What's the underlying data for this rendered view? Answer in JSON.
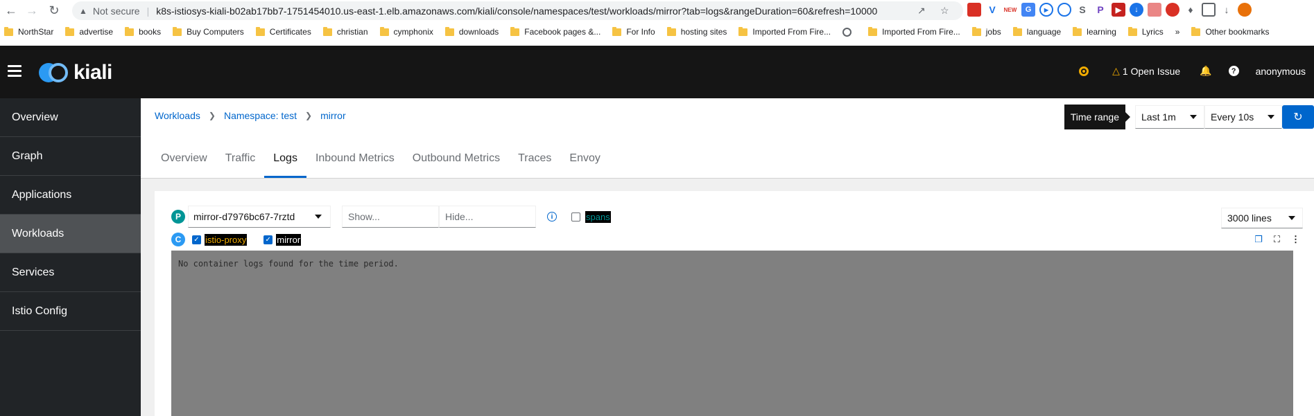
{
  "browser": {
    "not_secure": "Not secure",
    "url": "k8s-istiosys-kiali-b02ab17bb7-1751454010.us-east-1.elb.amazonaws.com/kiali/console/namespaces/test/workloads/mirror?tab=logs&rangeDuration=60&refresh=10000",
    "bookmarks": [
      "NorthStar",
      "advertise",
      "books",
      "Buy Computers",
      "Certificates",
      "christian",
      "cymphonix",
      "downloads",
      "Facebook pages &...",
      "For Info",
      "hosting sites",
      "Imported From Fire...",
      "Imported From Fire...",
      "jobs",
      "language",
      "learning",
      "Lyrics"
    ],
    "other_bookmarks": "Other bookmarks",
    "overflow": "»"
  },
  "masthead": {
    "logo_text": "kiali",
    "open_issue": "1 Open Issue",
    "user": "anonymous",
    "help": "?"
  },
  "sidebar": {
    "items": [
      "Overview",
      "Graph",
      "Applications",
      "Workloads",
      "Services",
      "Istio Config"
    ],
    "active": "Workloads"
  },
  "breadcrumb": {
    "items": [
      "Workloads",
      "Namespace: test",
      "mirror"
    ]
  },
  "toolbar": {
    "tooltip": "Time range",
    "time_range": "Last 1m",
    "refresh_interval": "Every 10s"
  },
  "tabs": {
    "items": [
      "Overview",
      "Traffic",
      "Logs",
      "Inbound Metrics",
      "Outbound Metrics",
      "Traces",
      "Envoy"
    ],
    "active": "Logs"
  },
  "logs": {
    "pod_badge": "P",
    "pod": "mirror-d7976bc67-7rztd",
    "show_placeholder": "Show...",
    "hide_placeholder": "Hide...",
    "info": "i",
    "spans_label": "spans",
    "lines": "3000 lines",
    "container_badge": "C",
    "containers": [
      {
        "name": "istio-proxy",
        "color": "#f0ab00",
        "checked": true
      },
      {
        "name": "mirror",
        "color": "#ffffff",
        "checked": true
      }
    ],
    "empty_message": "No container logs found for the time period."
  }
}
